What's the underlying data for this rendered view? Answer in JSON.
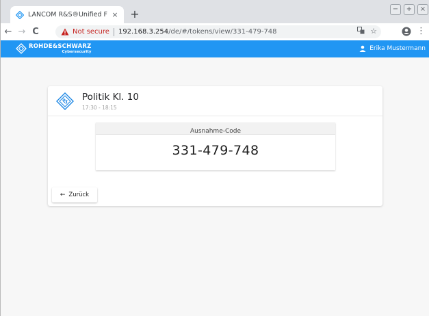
{
  "browser": {
    "tab_title": "LANCOM R&S®Unified Firewall",
    "tab_close": "×",
    "new_tab": "+",
    "window_buttons": [
      "−",
      "+",
      "×"
    ],
    "nav": {
      "back": "←",
      "forward": "→",
      "reload": "C"
    },
    "address": {
      "security_text": "Not secure",
      "host": "192.168.3.254",
      "path": "/de/#/tokens/view/331-479-748"
    },
    "menu": "⋮"
  },
  "app": {
    "brand": "ROHDE&SCHWARZ",
    "brand_sub": "Cybersecurity",
    "user_name": "Erika Mustermann",
    "accent_color": "#2196f3"
  },
  "card": {
    "title": "Politik Kl. 10",
    "time": "17:30 - 18:15",
    "code_label": "Ausnahme-Code",
    "code_value": "331-479-748",
    "back_arrow": "←",
    "back_label": "Zurück"
  }
}
